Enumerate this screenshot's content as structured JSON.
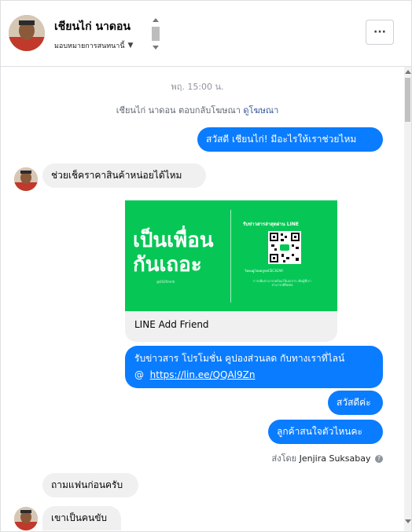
{
  "header": {
    "contact_name": "เชียนไก่ นาดอน",
    "assign_label": "มอบหมายการสนทนานี้",
    "more_label": "···"
  },
  "conversation": {
    "timestamp": "พฤ. 15:00 น.",
    "ad_notice": "เชียนไก่ นาดอน ตอบกลับโฆษณา",
    "ad_link": "ดูโฆษณา",
    "messages": [
      {
        "from": "page",
        "text": "สวัสดี เชียนไก่! มีอะไรให้เราช่วยไหม"
      },
      {
        "from": "user",
        "text": "ช่วยเช็คราคาสินค้าหน่อยได้ไหม"
      },
      {
        "from": "page",
        "text_line1": "รับข่าวสาร  โปรโมชั่น คูปองส่วนลด กับทางเราที่ไลน์",
        "text_line2_prefix": "@",
        "link": "https://lin.ee/QQAl9Zn"
      },
      {
        "from": "page",
        "text": "สวัสดีค่ะ"
      },
      {
        "from": "page",
        "text": "ลูกค้าสนใจตัวไหนคะ"
      },
      {
        "from": "user",
        "text": "ถามแฟนก่อนครับ"
      },
      {
        "from": "user",
        "text": "เขาเป็นคนขับ"
      }
    ],
    "card": {
      "title": "LINE Add Friend",
      "image_headline_1": "เป็นเพื่อน",
      "image_headline_2": "กันเถอะ",
      "image_caption": "@042fmmh",
      "image_top_text": "รับข่าวสารล่าสุดผ่าน LINE",
      "image_line_id": "ใจคนคูโหมดลูกคCEC3CAR",
      "image_note": "การเพิ่มสามารถพร้อมให้เอกสาร เพิ่มผู้ที่เราสามารถที่ติดต่อ"
    },
    "sent_by_label": "ส่งโดย",
    "sent_by_name": "Jenjira Suksabay"
  },
  "colors": {
    "outgoing_bubble": "#0a7cff",
    "incoming_bubble": "#f0f0f0",
    "line_green": "#06c755",
    "link_blue": "#385898"
  },
  "icons": [
    "more-icon",
    "caret-down-icon",
    "info-icon",
    "qr-code-icon",
    "scroll-up-icon",
    "scroll-down-icon"
  ]
}
